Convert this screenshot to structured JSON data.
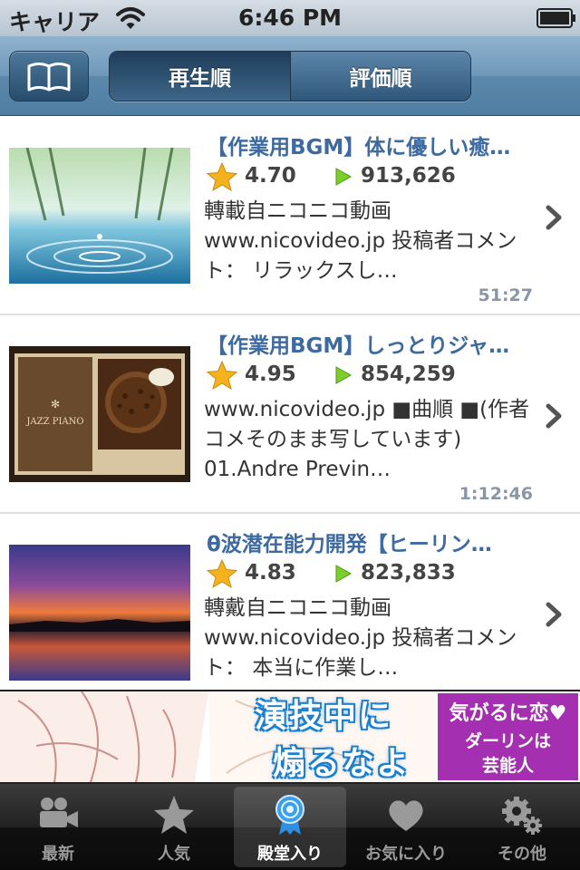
{
  "status_bar": {
    "carrier": "キャリア",
    "time": "6:46 PM"
  },
  "nav": {
    "segments": [
      {
        "label": "再生順",
        "selected": true
      },
      {
        "label": "評価順",
        "selected": false
      }
    ]
  },
  "items": [
    {
      "title": "【作業用BGM】体に優しい癒…",
      "rating": "4.70",
      "views": "913,626",
      "description": "轉載自ニコニコ動画 www.nicovideo.jp 投稿者コメント： リラックスし…",
      "duration": "51:27"
    },
    {
      "title": "【作業用BGM】しっとりジャ…",
      "rating": "4.95",
      "views": "854,259",
      "description": "www.nicovideo.jp ■曲順 ■(作者コメそのまま写しています) 01.Andre Previn…",
      "duration": "1:12:46"
    },
    {
      "title": "θ波潜在能力開発【ヒーリン…",
      "rating": "4.83",
      "views": "823,833",
      "description": "轉戴自ニコニコ動画 www.nicovideo.jp 投稿者コメント： 本当に作業し…",
      "duration": ""
    }
  ],
  "banner": {
    "line1": "演技中に",
    "line2": "煽るなよ",
    "side_line1": "気がるに恋♥",
    "side_line2": "ダーリンは",
    "side_line3": "芸能人"
  },
  "tabs": [
    {
      "label": "最新",
      "icon": "video-camera-icon",
      "selected": false
    },
    {
      "label": "人気",
      "icon": "star-icon",
      "selected": false
    },
    {
      "label": "殿堂入り",
      "icon": "award-ribbon-icon",
      "selected": true
    },
    {
      "label": "お気に入り",
      "icon": "heart-icon",
      "selected": false
    },
    {
      "label": "その他",
      "icon": "gears-icon",
      "selected": false
    }
  ],
  "colors": {
    "nav_accent": "#5c88ab",
    "title_text": "#3d6aa0",
    "banner_purple": "#a42fb0",
    "banner_blue": "#1a7fcf"
  }
}
